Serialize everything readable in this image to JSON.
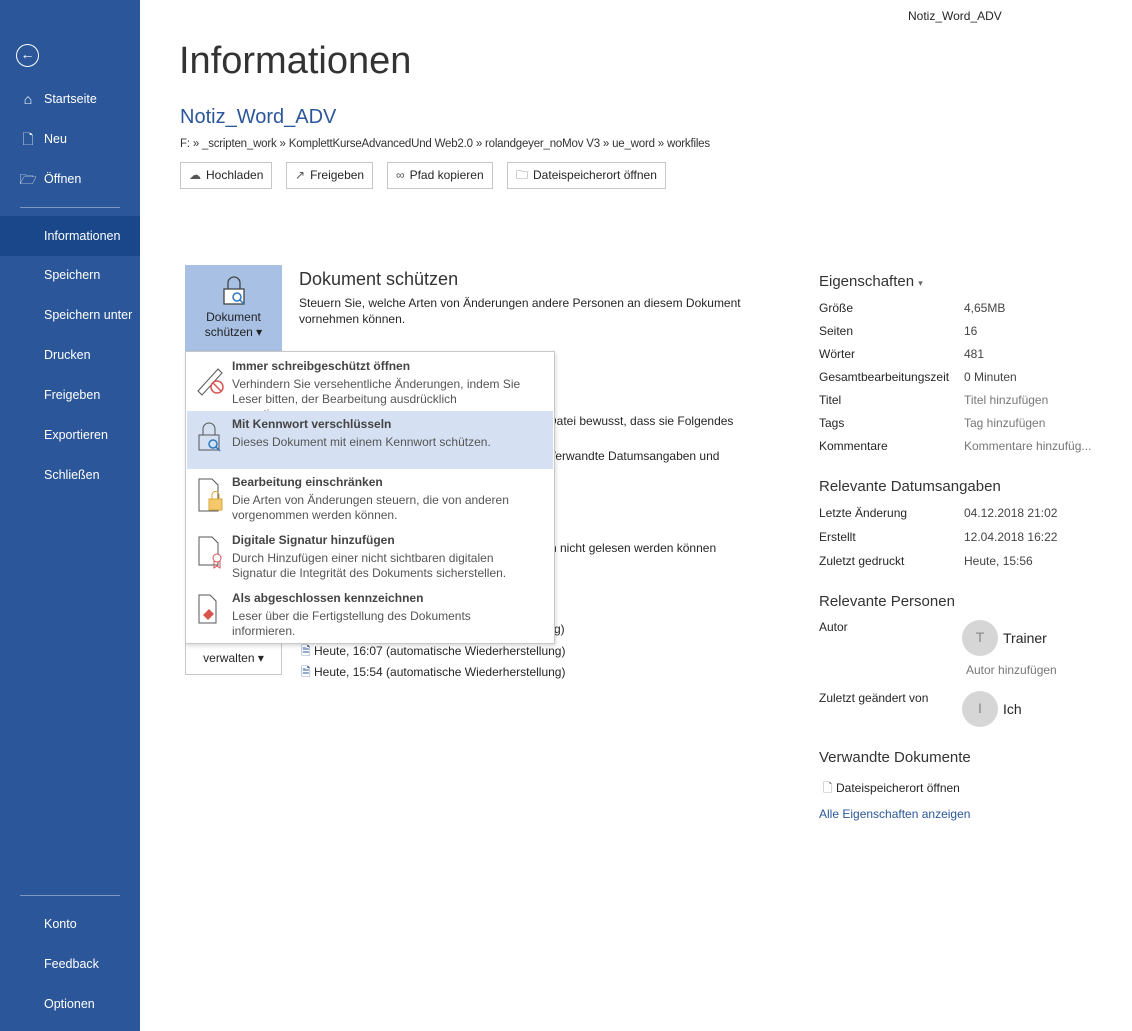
{
  "window_title": "Notiz_Word_ADV",
  "sidebar": {
    "back_label": "Zurück",
    "items": [
      {
        "label": "Startseite",
        "icon": "home-icon"
      },
      {
        "label": "Neu",
        "icon": "new-document-icon"
      },
      {
        "label": "Öffnen",
        "icon": "folder-open-icon"
      },
      {
        "label": "Informationen",
        "selected": true
      },
      {
        "label": "Speichern"
      },
      {
        "label": "Speichern unter"
      },
      {
        "label": "Drucken"
      },
      {
        "label": "Freigeben"
      },
      {
        "label": "Exportieren"
      },
      {
        "label": "Schließen"
      }
    ],
    "bottom_items": [
      {
        "label": "Konto"
      },
      {
        "label": "Feedback"
      },
      {
        "label": "Optionen"
      }
    ]
  },
  "main": {
    "title": "Informationen",
    "doc_name": "Notiz_Word_ADV",
    "path": "F: » _scripten_work » KomplettKurseAdvancedUnd Web2.0 » rolandgeyer_noMov V3 » ue_word » workfiles",
    "buttons": [
      {
        "label": "Hochladen",
        "icon": "upload-icon"
      },
      {
        "label": "Freigeben",
        "icon": "share-icon"
      },
      {
        "label": "Pfad kopieren",
        "icon": "link-icon"
      },
      {
        "label": "Dateispeicherort öffnen",
        "icon": "folder-icon"
      }
    ],
    "protect": {
      "button_line1": "Dokument",
      "button_line2": "schützen",
      "heading": "Dokument schützen",
      "description": "Steuern Sie, welche Arten von Änderungen andere Personen an diesem Dokument vornehmen können."
    },
    "occluded_fragments": [
      "Datei bewusst, dass sie Folgendes",
      "Verwandte Datumsangaben und",
      "n nicht gelesen werden können",
      "g)"
    ],
    "manage_button": "verwalten",
    "versions": [
      "Heute, 16:07 (automatische Wiederherstellung)",
      "Heute, 15:54 (automatische Wiederherstellung)"
    ]
  },
  "protect_menu": [
    {
      "title": "Immer schreibgeschützt öffnen",
      "desc": "Verhindern Sie versehentliche Änderungen, indem Sie Leser bitten, der Bearbeitung ausdrücklich zuzustimmen.",
      "icon": "pencil-prohibited-icon"
    },
    {
      "title": "Mit Kennwort verschlüsseln",
      "desc": "Dieses Dokument mit einem Kennwort schützen.",
      "icon": "lock-key-icon",
      "highlighted": true
    },
    {
      "title": "Bearbeitung einschränken",
      "desc": "Die Arten von Änderungen steuern, die von anderen vorgenommen werden können.",
      "icon": "document-lock-icon"
    },
    {
      "title": "Digitale Signatur hinzufügen",
      "desc": "Durch Hinzufügen einer nicht sichtbaren digitalen Signatur die Integrität des Dokuments sicherstellen.",
      "icon": "document-ribbon-icon"
    },
    {
      "title": "Als abgeschlossen kennzeichnen",
      "desc": "Leser über die Fertigstellung des Dokuments informieren.",
      "icon": "document-stamp-icon"
    }
  ],
  "properties": {
    "heading": "Eigenschaften",
    "rows": [
      {
        "label": "Größe",
        "value": "4,65MB"
      },
      {
        "label": "Seiten",
        "value": "16"
      },
      {
        "label": "Wörter",
        "value": "481"
      },
      {
        "label": "Gesamtbearbeitungszeit",
        "value": "0 Minuten"
      },
      {
        "label": "Titel",
        "value": "Titel hinzufügen"
      },
      {
        "label": "Tags",
        "value": "Tag hinzufügen"
      },
      {
        "label": "Kommentare",
        "value": "Kommentare hinzufüg..."
      }
    ],
    "dates_heading": "Relevante Datumsangaben",
    "dates": [
      {
        "label": "Letzte Änderung",
        "value": "04.12.2018 21:02"
      },
      {
        "label": "Erstellt",
        "value": "12.04.2018 16:22"
      },
      {
        "label": "Zuletzt gedruckt",
        "value": "Heute, 15:56"
      }
    ],
    "people_heading": "Relevante Personen",
    "author_label": "Autor",
    "author_initial": "T",
    "author_name": "Trainer",
    "add_author": "Autor hinzufügen",
    "modified_label": "Zuletzt geändert von",
    "modified_initial": "I",
    "modified_name": "Ich",
    "related_heading": "Verwandte Dokumente",
    "open_location": "Dateispeicherort öffnen",
    "show_all": "Alle Eigenschaften anzeigen"
  },
  "colors": {
    "sidebar": "#2b579a",
    "sidebar_selected": "#19478a",
    "menu_highlight": "#d5e1f2",
    "link": "#2b579a"
  }
}
